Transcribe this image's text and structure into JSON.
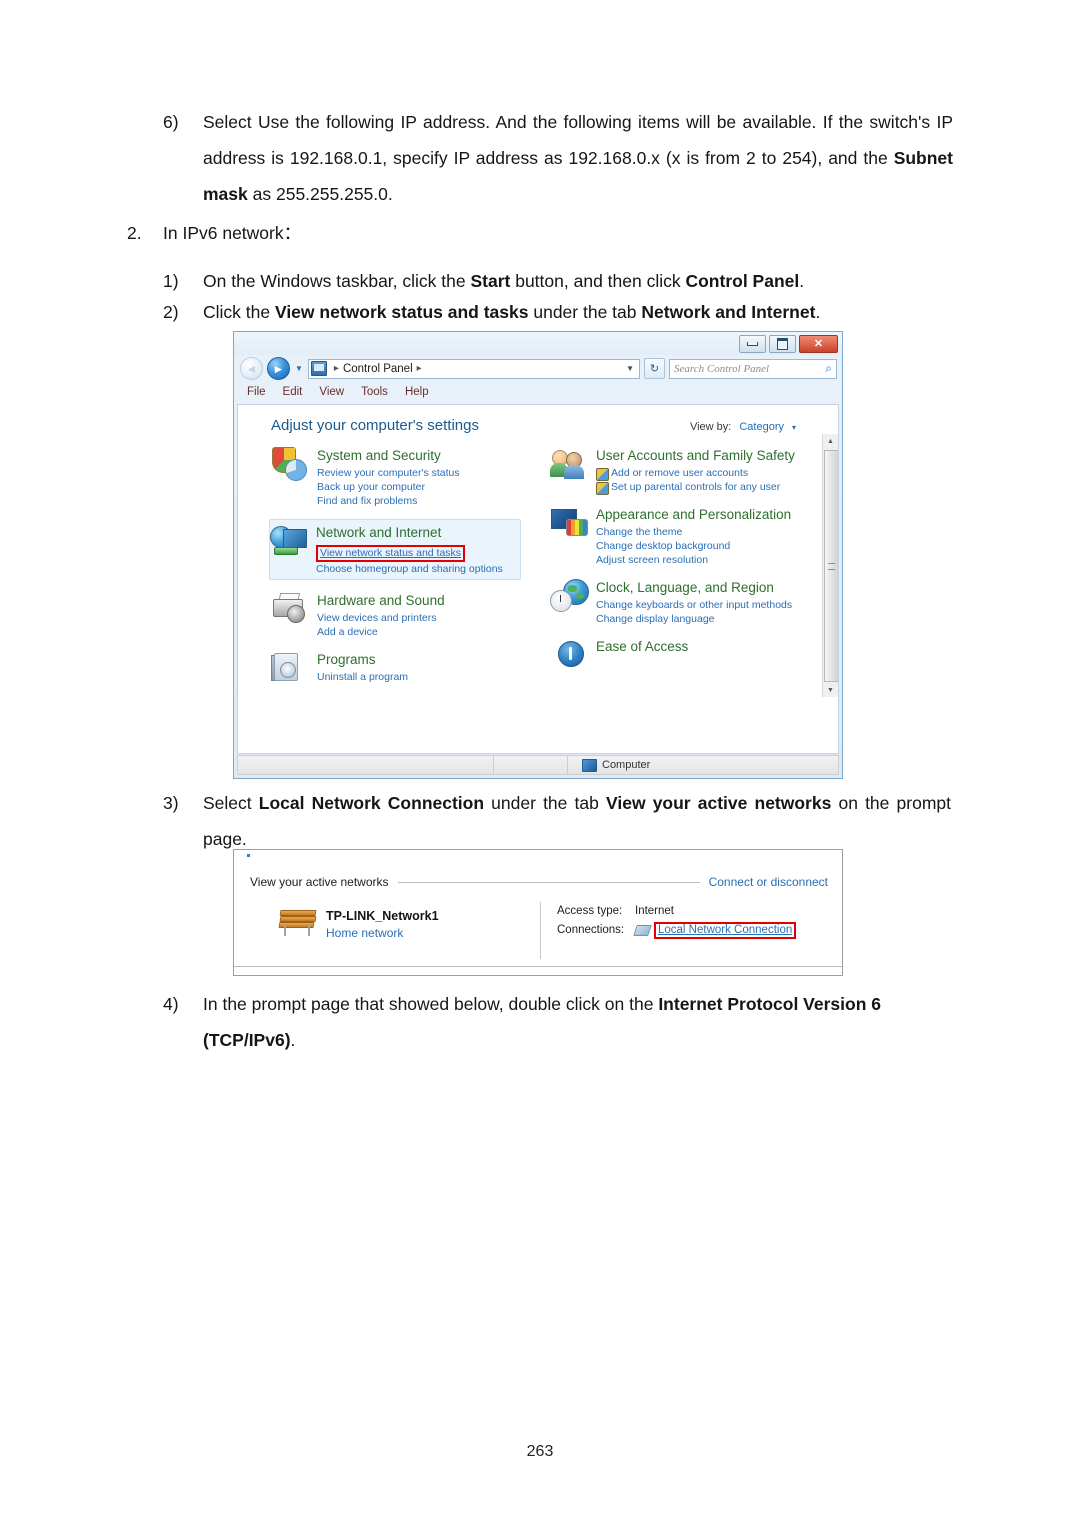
{
  "document": {
    "page_number": "263",
    "items": [
      {
        "marker": "6)",
        "text_parts": [
          {
            "t": "Select Use the following IP address. And the following items will be available. If the switch's IP address is 192.168.0.1, specify IP address as 192.168.0.x (x is from 2 to 254), and the ",
            "bold": false
          },
          {
            "t": "Subnet mask",
            "bold": true
          },
          {
            "t": " as 255.255.255.0.",
            "bold": false
          }
        ]
      },
      {
        "marker": "2.",
        "text_parts": [
          {
            "t": "In IPv6 network：",
            "bold": false
          }
        ]
      },
      {
        "marker": "1)",
        "text_parts": [
          {
            "t": "On the Windows taskbar, click the ",
            "bold": false
          },
          {
            "t": "Start",
            "bold": true
          },
          {
            "t": " button, and then click ",
            "bold": false
          },
          {
            "t": "Control Panel",
            "bold": true
          },
          {
            "t": ".",
            "bold": false
          }
        ]
      },
      {
        "marker": "2)",
        "text_parts": [
          {
            "t": "Click the ",
            "bold": false
          },
          {
            "t": "View network status and tasks",
            "bold": true
          },
          {
            "t": " under the tab ",
            "bold": false
          },
          {
            "t": "Network and Internet",
            "bold": true
          },
          {
            "t": ".",
            "bold": false
          }
        ]
      },
      {
        "marker": "3)",
        "text_parts": [
          {
            "t": "Select ",
            "bold": false
          },
          {
            "t": "Local Network Connection",
            "bold": true
          },
          {
            "t": " under the tab ",
            "bold": false
          },
          {
            "t": "View your active networks",
            "bold": true
          },
          {
            "t": " on the prompt page.",
            "bold": false
          }
        ]
      },
      {
        "marker": "4)",
        "text_parts": [
          {
            "t": "In the prompt page that showed below, double click on the ",
            "bold": false
          },
          {
            "t": "Internet Protocol Version 6 (TCP/IPv6)",
            "bold": true
          },
          {
            "t": ".",
            "bold": false
          }
        ]
      }
    ],
    "step6_marker": "6)",
    "step6_a": "Select Use the following IP address. And the following items will be available. If the switch's IP address is 192.168.0.1, specify IP address as 192.168.0.x (x is from 2 to 254), and the ",
    "step6_bold": "Subnet mask",
    "step6_b": " as 255.255.255.0.",
    "step2_marker": "2.",
    "step2_text": "In IPv6 network：",
    "step1_marker": "1)",
    "step1_a": "On the Windows taskbar, click the ",
    "step1_b1": "Start",
    "step1_b": " button, and then click ",
    "step1_b2": "Control Panel",
    "step1_c": ".",
    "step2b_marker": "2)",
    "step2b_a": "Click the ",
    "step2b_b1": "View network status and tasks",
    "step2b_b": " under the tab ",
    "step2b_b2": "Network and Internet",
    "step2b_c": ".",
    "step3_marker": "3)",
    "step3_a": "Select ",
    "step3_b1": "Local Network Connection",
    "step3_b": " under the tab ",
    "step3_b2": "View your active networks",
    "step3_c": " on the prompt page.",
    "step4_marker": "4)",
    "step4_a": "In the prompt page that showed below, double click on the ",
    "step4_b1": "Internet Protocol Version 6 (TCP/IPv6)",
    "step4_c": "."
  },
  "control_panel": {
    "window_buttons": {
      "minimize": "minimize-icon",
      "maximize": "maximize-icon",
      "close": "✕"
    },
    "address": {
      "crumb_root": "Control Panel",
      "sep": "▸",
      "caret": "▼",
      "refresh_glyph": "↻"
    },
    "search": {
      "placeholder": "Search Control Panel",
      "icon": "⌕"
    },
    "menu": [
      "File",
      "Edit",
      "View",
      "Tools",
      "Help"
    ],
    "heading": "Adjust your computer's settings",
    "view_by": {
      "label": "View by:",
      "value": "Category",
      "caret": "▾"
    },
    "categories_left": [
      {
        "title": "System and Security",
        "icon": "shield-pie-icon",
        "links": [
          "Review your computer's status",
          "Back up your computer",
          "Find and fix problems"
        ]
      },
      {
        "title": "Network and Internet",
        "icon": "globe-network-icon",
        "highlighted": true,
        "links": [
          "View network status and tasks",
          "Choose homegroup and sharing options"
        ],
        "red_box_link": "View network status and tasks"
      },
      {
        "title": "Hardware and Sound",
        "icon": "printer-speaker-icon",
        "links": [
          "View devices and printers",
          "Add a device"
        ]
      },
      {
        "title": "Programs",
        "icon": "programs-box-icon",
        "links": [
          "Uninstall a program"
        ]
      }
    ],
    "categories_right": [
      {
        "title": "User Accounts and Family Safety",
        "icon": "users-icon",
        "links": [
          "Add or remove user accounts",
          "Set up parental controls for any user"
        ],
        "shielded": true
      },
      {
        "title": "Appearance and Personalization",
        "icon": "monitor-palette-icon",
        "links": [
          "Change the theme",
          "Change desktop background",
          "Adjust screen resolution"
        ]
      },
      {
        "title": "Clock, Language, and Region",
        "icon": "clock-globe-icon",
        "links": [
          "Change keyboards or other input methods",
          "Change display language"
        ]
      },
      {
        "title": "Ease of Access",
        "icon": "ease-of-access-icon",
        "links": []
      }
    ],
    "status_bar": {
      "computer_label": "Computer",
      "computer_icon": "computer-icon"
    },
    "colors": {
      "category_title": "#2e6f2e",
      "link": "#2a6fb5",
      "heading": "#1b5a8e",
      "highlight_box": "#e00000"
    }
  },
  "network_panel": {
    "section_label": "View your active networks",
    "connect_link": "Connect or disconnect",
    "network_name": "TP-LINK_Network1",
    "network_type": "Home network",
    "network_icon": "bench-icon",
    "details": [
      {
        "key": "Access type:",
        "value": "Internet",
        "is_link": false
      },
      {
        "key": "Connections:",
        "value": "Local Network Connection",
        "is_link": true,
        "highlighted": true
      }
    ],
    "connection_icon": "network-adapter-icon"
  }
}
